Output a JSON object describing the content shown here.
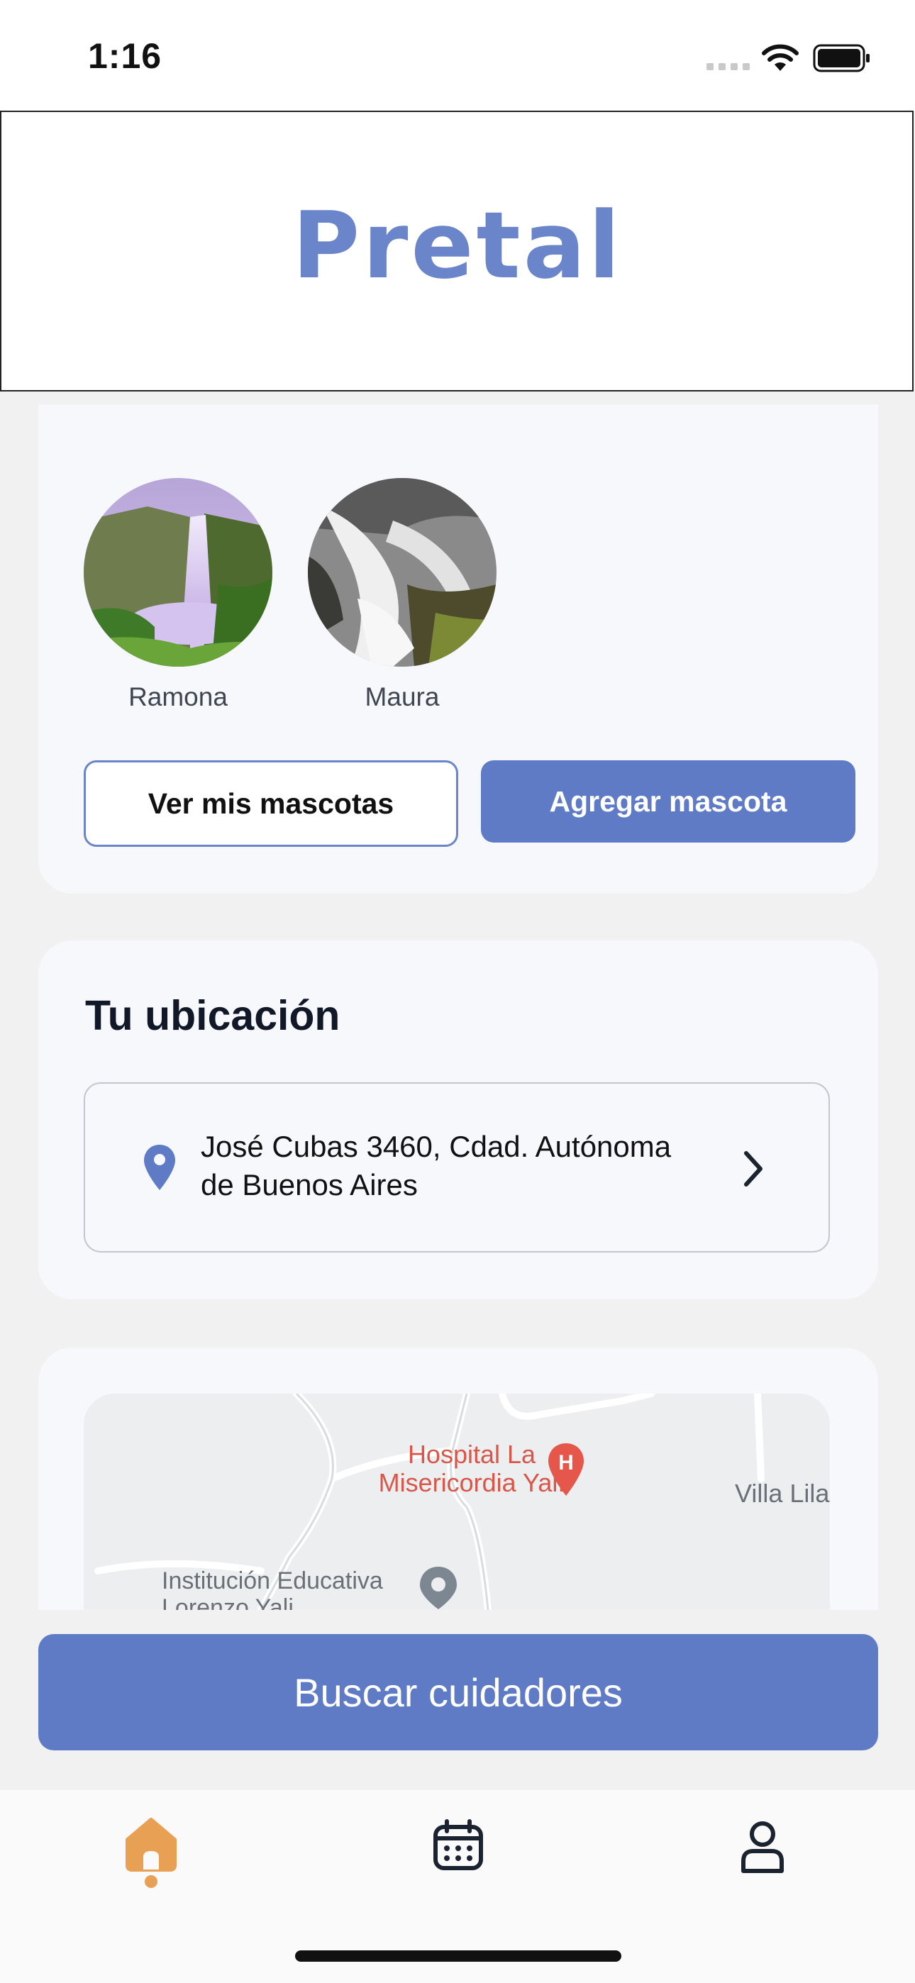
{
  "status": {
    "time": "1:16"
  },
  "header": {
    "logo": "Pretal"
  },
  "pets": {
    "items": [
      {
        "name": "Ramona"
      },
      {
        "name": "Maura"
      }
    ],
    "view_button": "Ver mis mascotas",
    "add_button": "Agregar mascota"
  },
  "location": {
    "title": "Tu ubicación",
    "address_line1": "José Cubas 3460, Cdad. Autónoma",
    "address_line2": "de Buenos Aires"
  },
  "map": {
    "poi_hospital_1": "Hospital La",
    "poi_hospital_2": "Misericordia Yalí",
    "poi_villa": "Villa Lila",
    "poi_school_1": "Institución Educativa",
    "poi_school_2": "Lorenzo Yali"
  },
  "actions": {
    "search_button": "Buscar cuidadores"
  },
  "colors": {
    "accent": "#5f7bc6",
    "home_active": "#e8a055"
  }
}
